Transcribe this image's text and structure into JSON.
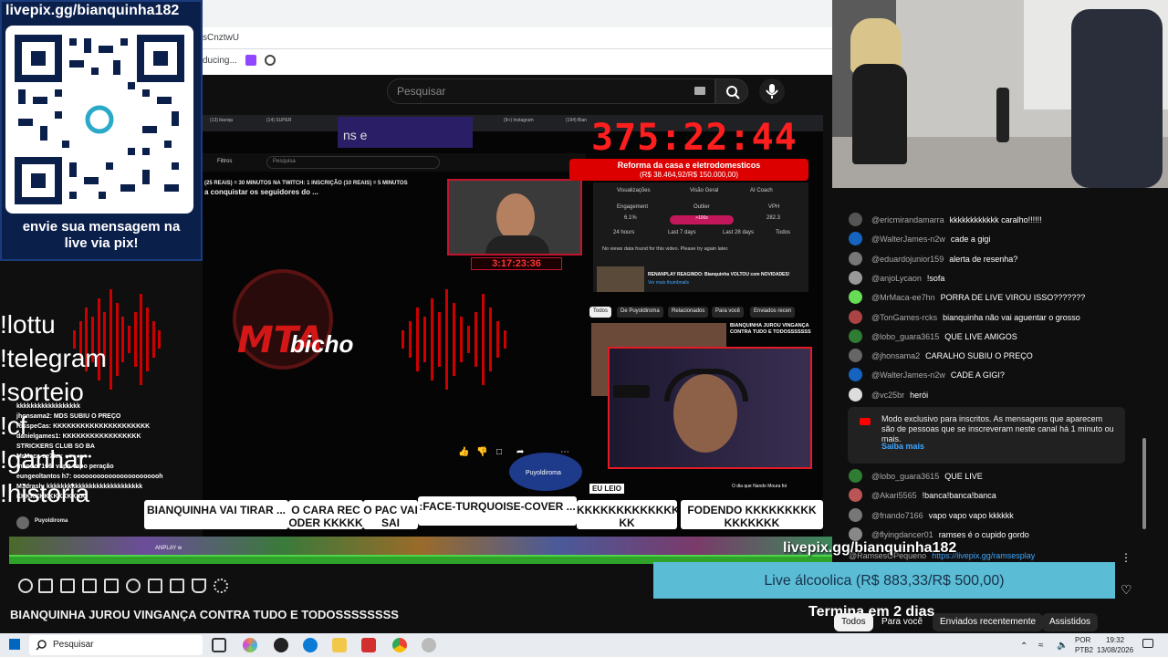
{
  "browser": {
    "url_fragment": "sCnztwU",
    "bookmark_text": "ducing..."
  },
  "youtube": {
    "search_placeholder": "Pesquisar",
    "video_title": "BIANQUINHA JUROU VINGANÇA CONTRA TUDO E TODOSSSSSSSS",
    "bottom_tabs": [
      "Todos",
      "Para você",
      "Enviados recentemente",
      "Assistidos"
    ]
  },
  "inner_stream": {
    "tabs": [
      "(13) bianqu",
      "(14) SUPER",
      "(9+) Instagram",
      "(194) Bian"
    ],
    "purple_text": "ns e",
    "search_placeholder": "Pesquisa",
    "filters_label": "Filtros",
    "line1": "(25 REAIS) = 30 MINUTOS    NA TWITCH: 1 INSCRIÇÃO (10 REAIS) = 5 MINUTOS",
    "line2": "a conquistar os seguidores do ...",
    "cam_small_timer": "3:17:23:36",
    "timer": "375:22:44",
    "goal_title": "Reforma da casa e eletrodomesticos",
    "goal_amount": "(R$ 38.464,92/R$ 150.000,00)",
    "analytics": {
      "tabs": [
        "Visualizações",
        "Visão Geral",
        "AI Coach"
      ],
      "engagement_label": "Engagement",
      "engagement_value": "6.1%",
      "outlier_label": "Outlier",
      "outlier_value": ">100x",
      "vph_label": "VPH",
      "vph_value": "282.3",
      "range_labels": [
        "24 hours",
        "Last 7 days",
        "Last 28 days",
        "Todos"
      ],
      "no_data": "No views data found for this video. Please try again later.",
      "rec_title": "RENANPLAY REAGINDO: Bianquinha VOLTOU com NOVIDADES!",
      "rec_link": "Ver mais thumbnails"
    },
    "chips": [
      "Todos",
      "De Puyoldiroma",
      "Relacionados",
      "Para você",
      "Enviados recen"
    ],
    "related_title": "BIANQUINHA JUROU VINGANÇA CONTRA TUDO E TODOSSSSSSS",
    "logo_main": "MTA",
    "logo_sub": "bicho",
    "channel_name": "Puyoldiroma",
    "overlay_channel": "Puyoldiroma",
    "eu_leio": "EU LEIO",
    "side_snippet": "O dia que Nando Moura foi",
    "ground_text": "ANPLAY w"
  },
  "donations": [
    "BIANQUINHA VAI TIRAR ...",
    "O CARA REC ODER KKKKK",
    "O PAC VAI SAI",
    ":FACE-TURQUOISE-COVER ...",
    "KKKKKKKKKKKKK KK",
    "FODENDO KKKKKKKKK KKKKKKK"
  ],
  "commands": [
    "!lottu",
    "!telegram",
    "!sorteio",
    "!cf",
    "!ganhar",
    "!historia"
  ],
  "left_chat": [
    "kkkkkkkkkkkkkkkkkk",
    "jhonsama2: MDS SUBIU O PREÇO",
    "RisspeCas: KKKKKKKKKKKKKKKKKKKKK",
    "danielgames1: KKKKKKKKKKKKKKKKK",
    "STRICKERS CLUB SO BA",
    "MrMaca-ee7hn: ●●●●●●●",
    "fnando7166: vapo vapo peração",
    "eungeoltantos h7: ooooooooooooooooooooooh",
    "M3drash: kkkkkkkkkkkkkkkkkkkkkkkkkkk",
    "KKKKKKKKKKKKKKK"
  ],
  "qr_panel": {
    "url": "livepix.gg/bianquinha182",
    "caption_line1": "envie sua mensagem na",
    "caption_line2": "live via pix!"
  },
  "chat": {
    "messages": [
      {
        "user": "@ericmirandamarra",
        "text": "kkkkkkkkkkkk caralho!!!!!!",
        "color": "#555"
      },
      {
        "user": "@WalterJames-n2w",
        "text": "cade a gigi",
        "color": "#1565c0"
      },
      {
        "user": "@eduardojunior159",
        "text": "alerta de resenha?",
        "color": "#777"
      },
      {
        "user": "@anjoLycaon",
        "text": "!sofa",
        "color": "#999"
      },
      {
        "user": "@MrMaca-ee7hn",
        "text": "PORRA DE LIVE VIROU ISSO???????",
        "color": "#6d5"
      },
      {
        "user": "@TonGames-rcks",
        "text": "bianquinha não vai aguentar o grosso",
        "color": "#a44"
      },
      {
        "user": "@lobo_guara3615",
        "text": "QUE LIVE AMIGOS",
        "color": "#2e7d32"
      },
      {
        "user": "@jhonsama2",
        "text": "CARALHO SUBIU O PREÇO",
        "color": "#666"
      },
      {
        "user": "@WalterJames-n2w",
        "text": "CADE A GIGI?",
        "color": "#1565c0"
      },
      {
        "user": "@vc25br",
        "text": "herói",
        "color": "#ddd"
      }
    ],
    "members_notice": "Modo exclusivo para inscritos. As mensagens que aparecem são de pessoas que se inscreveram neste canal há 1 minuto ou mais.",
    "members_link": "Saiba mais",
    "messages2": [
      {
        "user": "@lobo_guara3615",
        "text": "QUE LIVE",
        "color": "#2e7d32"
      },
      {
        "user": "@Akari5565",
        "text": "!banca!banca!banca",
        "color": "#b55"
      },
      {
        "user": "@fnando7166",
        "text": "vapo vapo vapo kkkkkk",
        "color": "#777"
      },
      {
        "user": "@flyingdancer01",
        "text": "ramses é o cupido gordo",
        "color": "#888"
      }
    ],
    "pinned_user": "@RamsesOPequeno",
    "pinned_link": "https://livepix.gg/ramsesplay"
  },
  "overlay": {
    "pix_url": "livepix.gg/bianquinha182",
    "goal_text": "Live álcoolica (R$ 883,33/R$ 500,00)",
    "ends_text": "Termina em 2 dias"
  },
  "taskbar": {
    "search_label": "Pesquisar",
    "lang1": "POR",
    "lang2": "PTB2",
    "time": "19:32",
    "date": "13/08/2026"
  }
}
